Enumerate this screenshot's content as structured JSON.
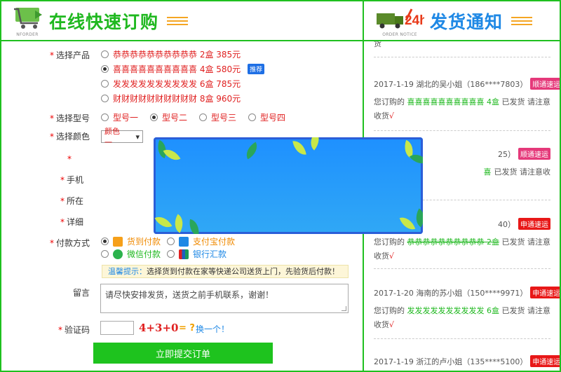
{
  "header": {
    "left_title": "在线快速订购",
    "left_icon_caption": "NFORDER",
    "right_title": "发货通知",
    "right_icon_caption": "ORDER NOTICE",
    "right_icon_badge": "24h"
  },
  "form": {
    "product_label": "选择产品",
    "products": [
      {
        "text": "恭恭恭恭恭恭恭恭恭恭 2盒 385元",
        "selected": false,
        "tag": ""
      },
      {
        "text": "喜喜喜喜喜喜喜喜喜喜 4盒 580元",
        "selected": true,
        "tag": "推荐"
      },
      {
        "text": "发发发发发发发发发发 6盒 785元",
        "selected": false,
        "tag": ""
      },
      {
        "text": "财财财财财财财财财财 8盒 960元",
        "selected": false,
        "tag": ""
      }
    ],
    "model_label": "选择型号",
    "models": [
      {
        "text": "型号一",
        "selected": false
      },
      {
        "text": "型号二",
        "selected": true
      },
      {
        "text": "型号三",
        "selected": false
      },
      {
        "text": "型号四",
        "selected": false
      }
    ],
    "color_label": "选择颜色",
    "color_value": "颜色一",
    "phone_label_partial": "手机",
    "region_label_partial": "所在",
    "address_label_partial": "详细",
    "payment_label": "付款方式",
    "payments": [
      {
        "text": "货到付款",
        "selected": true
      },
      {
        "text": "支付宝付款",
        "selected": false
      },
      {
        "text": "微信付款",
        "selected": false
      },
      {
        "text": "银行汇款",
        "selected": false
      }
    ],
    "tip_prefix": "温馨提示：",
    "tip_text": "选择货到付款在家等快递公司送货上门，先验货后付款！",
    "message_label": "留言",
    "message_value": "请尽快安排发货，送货之前手机联系，谢谢！",
    "captcha_label": "验证码",
    "captcha_value": "",
    "captcha_expr": "4+3+0",
    "captcha_question": "= ?",
    "captcha_refresh": "换一个！",
    "submit_label": "立即提交订单"
  },
  "notices": {
    "top_fragment": "货",
    "entries": [
      {
        "head": "2017-1-19 湖北的吴小姐（186****7803）",
        "badge": "顺通速运",
        "badge_color": "pink",
        "body_prefix": "您订购的",
        "product": "喜喜喜喜喜喜喜喜喜喜 4盒",
        "suffix": "已发货 请注意收货",
        "check": "√"
      },
      {
        "head": "25）",
        "badge": "顺通速运",
        "badge_color": "pink",
        "body_prefix": "",
        "product": "",
        "suffix": "已发货 请注意收",
        "check": ""
      },
      {
        "head": "40）",
        "badge": "申通速运",
        "badge_color": "red",
        "body_prefix": "您订购的",
        "product": "恭恭恭恭恭恭恭恭恭恭 2盒",
        "suffix": "已发货 请注意收货",
        "check": "√"
      },
      {
        "head": "2017-1-20 海南的苏小姐（150****9971）",
        "badge": "申通速运",
        "badge_color": "red",
        "body_prefix": "您订购的",
        "product": "发发发发发发发发发发 6盒",
        "suffix": "已发货 请注意收货",
        "check": "√"
      },
      {
        "head": "2017-1-19 浙江的卢小姐（135****5100）",
        "badge": "申通速运",
        "badge_color": "red",
        "body_prefix": "",
        "product": "",
        "suffix": "",
        "check": ""
      }
    ]
  },
  "colors": {
    "brand_green": "#1fc01f",
    "accent_blue": "#1e88e5",
    "accent_red": "#e02020",
    "accent_orange": "#f5a623"
  }
}
